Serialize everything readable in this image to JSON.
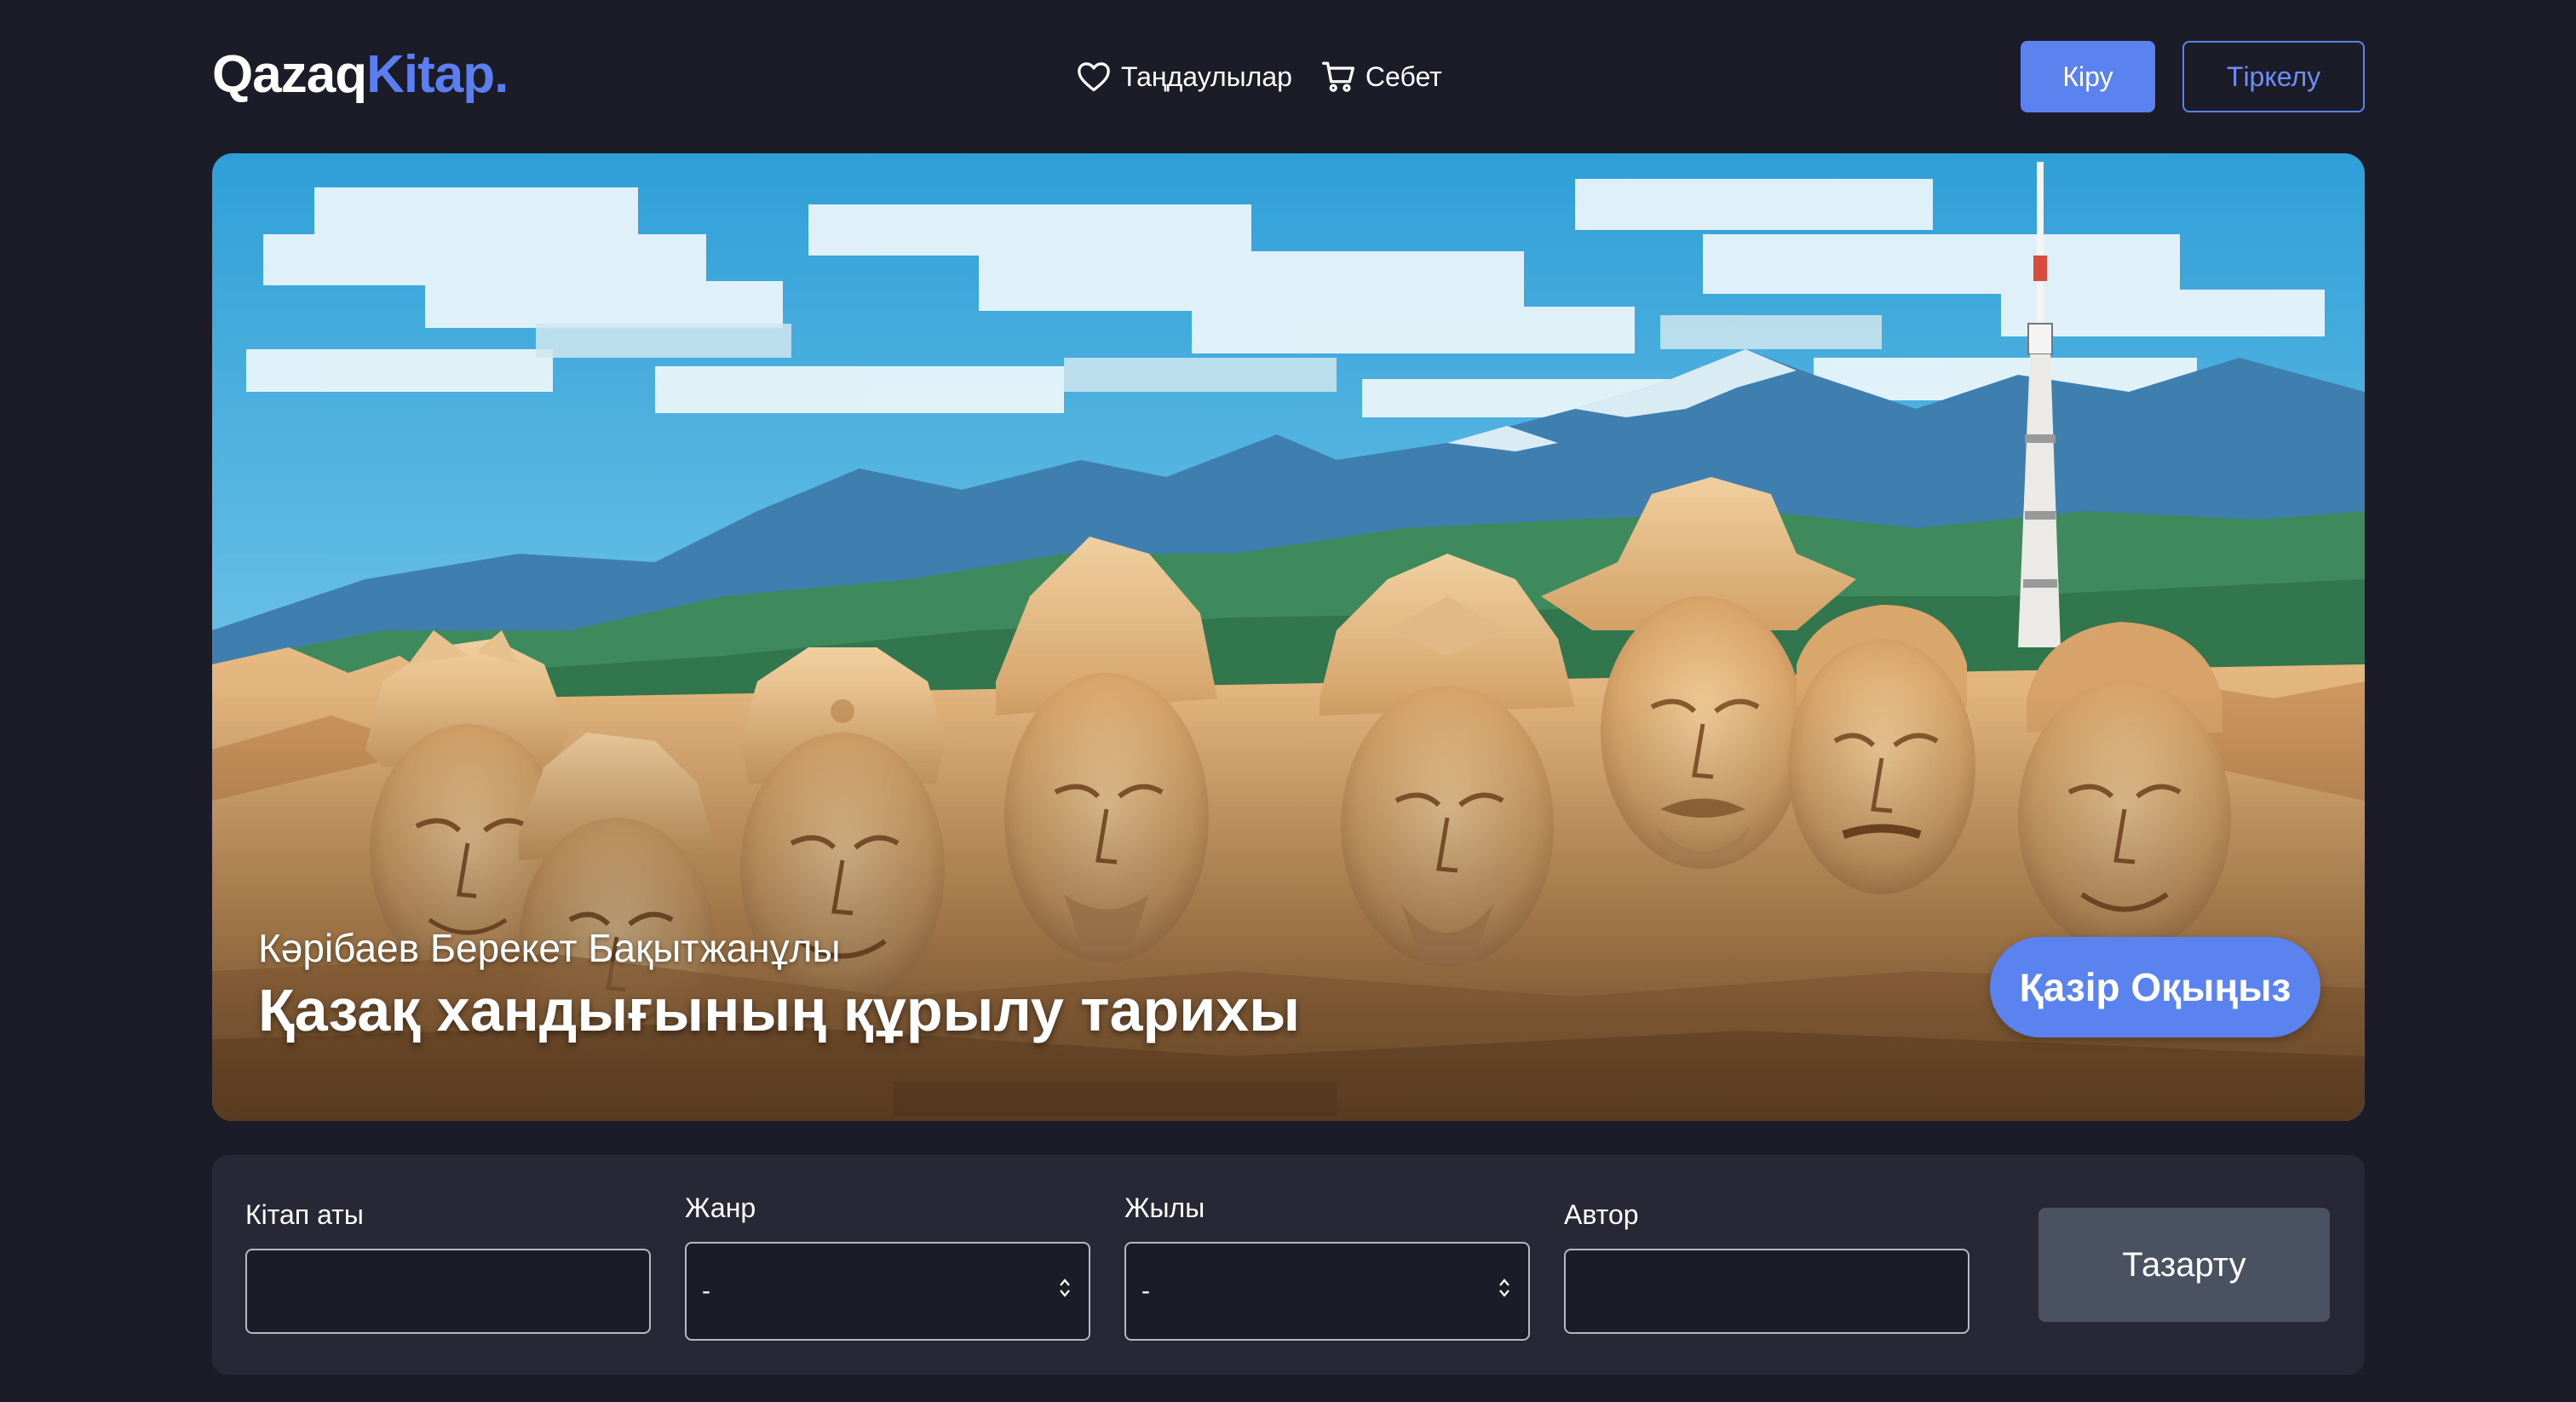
{
  "header": {
    "logo_part1": "Qazaq",
    "logo_part2": "Kitap.",
    "nav": {
      "favorites_label": "Таңдаулылар",
      "cart_label": "Себет"
    },
    "login_label": "Кіру",
    "register_label": "Тіркелу"
  },
  "hero": {
    "author": "Кәрібаев Берекет Бақытжанұлы",
    "title": "Қазақ хандығының құрылу тарихы",
    "read_button_label": "Қазір Оқыңыз",
    "image": "illustration of carved stone heads of historical figures in front of mountains and a TV tower"
  },
  "filters": {
    "book_name_label": "Кітап аты",
    "book_name_value": "",
    "genre_label": "Жанр",
    "genre_value": "-",
    "year_label": "Жылы",
    "year_value": "-",
    "author_label": "Автор",
    "author_value": "",
    "clear_label": "Тазарту"
  },
  "colors": {
    "background": "#1c1c29",
    "panel": "#272735",
    "accent": "#5b83f0",
    "clear_button": "#4a5262"
  }
}
